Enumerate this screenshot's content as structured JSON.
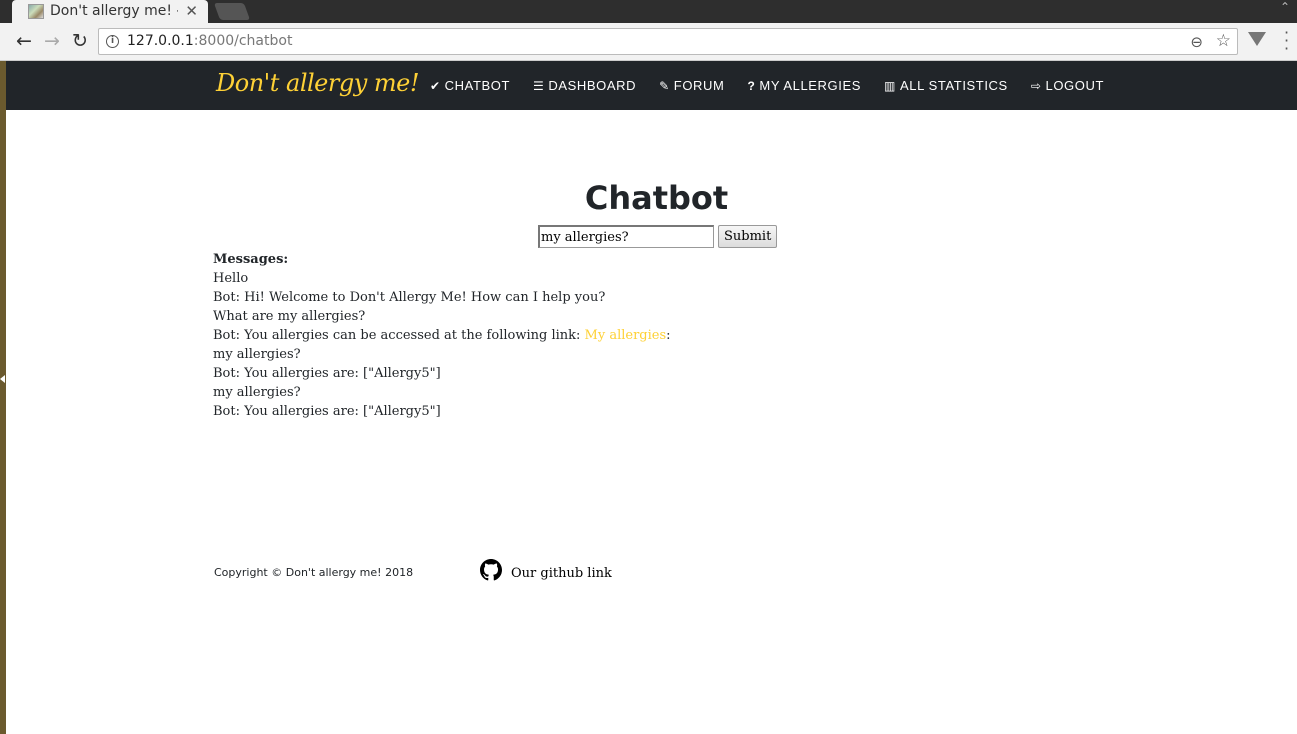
{
  "browser": {
    "tab_title": "Don't allergy me! - \\",
    "tab_close": "✕",
    "url_host": "127.0.0.1",
    "url_path": ":8000/chatbot"
  },
  "navbar": {
    "brand": "Don't allergy me!",
    "links": [
      {
        "label": "CHATBOT",
        "icon": "check-icon"
      },
      {
        "label": "DASHBOARD",
        "icon": "list-icon"
      },
      {
        "label": "FORUM",
        "icon": "edit-icon"
      },
      {
        "label": "MY ALLERGIES",
        "icon": "question-icon"
      },
      {
        "label": "ALL STATISTICS",
        "icon": "bar-chart-icon"
      },
      {
        "label": "LOGOUT",
        "icon": "sign-out-icon"
      }
    ]
  },
  "main": {
    "heading": "Chatbot",
    "input_value": "my allergies?",
    "submit_label": "Submit",
    "messages_title": "Messages:",
    "messages": [
      "Hello",
      "Bot: Hi! Welcome to Don't Allergy Me! How can I help you?",
      "What are my allergies?",
      "Bot: You allergies can be accessed at the following link: ",
      "my allergies?",
      "Bot: You allergies are: [\"Allergy5\"]",
      "my allergies?",
      "Bot: You allergies are: [\"Allergy5\"]"
    ],
    "link_text": "My allergies",
    "link_suffix": ":"
  },
  "footer": {
    "copyright": "Copyright © Don't allergy me! 2018",
    "github_label": "Our github link"
  },
  "colors": {
    "accent": "#fed136",
    "navbar_bg": "#212529"
  }
}
